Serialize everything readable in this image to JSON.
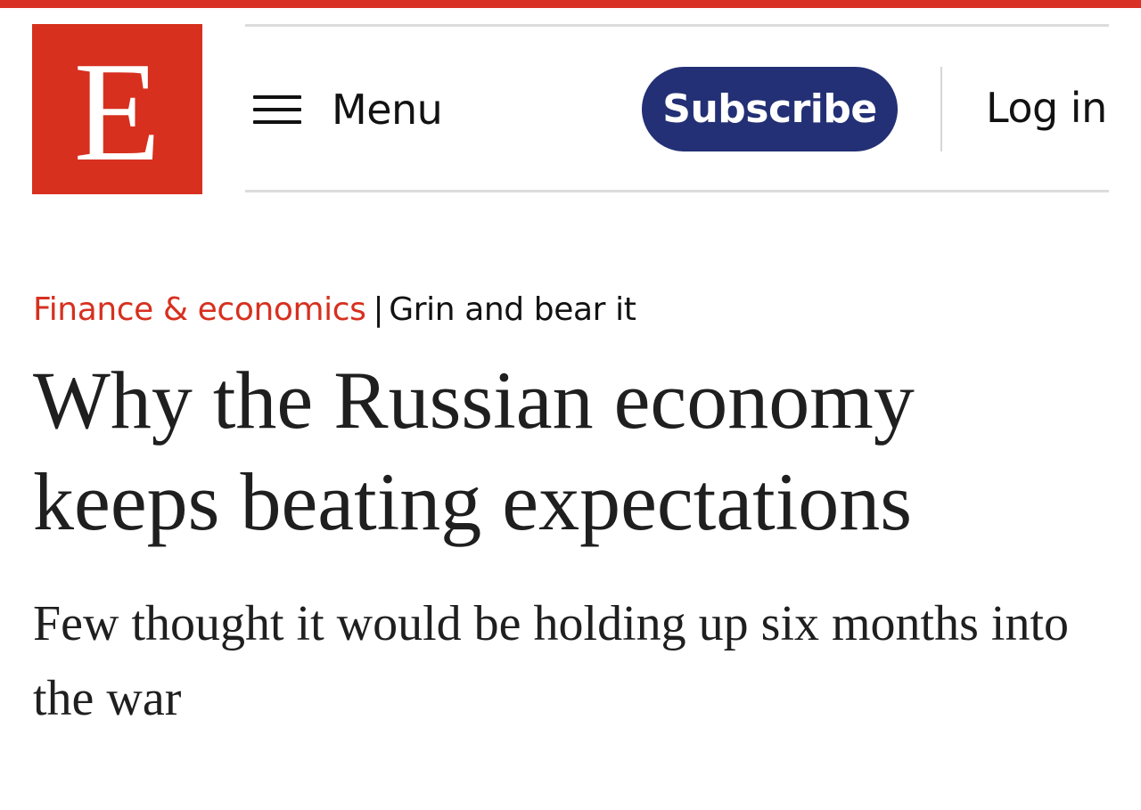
{
  "brand": {
    "logo_letter": "E",
    "accent_color": "#d7301f",
    "stripe_color": "#d93025"
  },
  "header": {
    "menu_label": "Menu",
    "subscribe_label": "Subscribe",
    "subscribe_color": "#233075",
    "login_label": "Log in"
  },
  "article": {
    "section": "Finance & economics",
    "separator": "|",
    "fly_title": "Grin and bear it",
    "headline": "Why the Russian economy keeps beating expectations",
    "subheadline": "Few thought it would be holding up six months into the war"
  }
}
